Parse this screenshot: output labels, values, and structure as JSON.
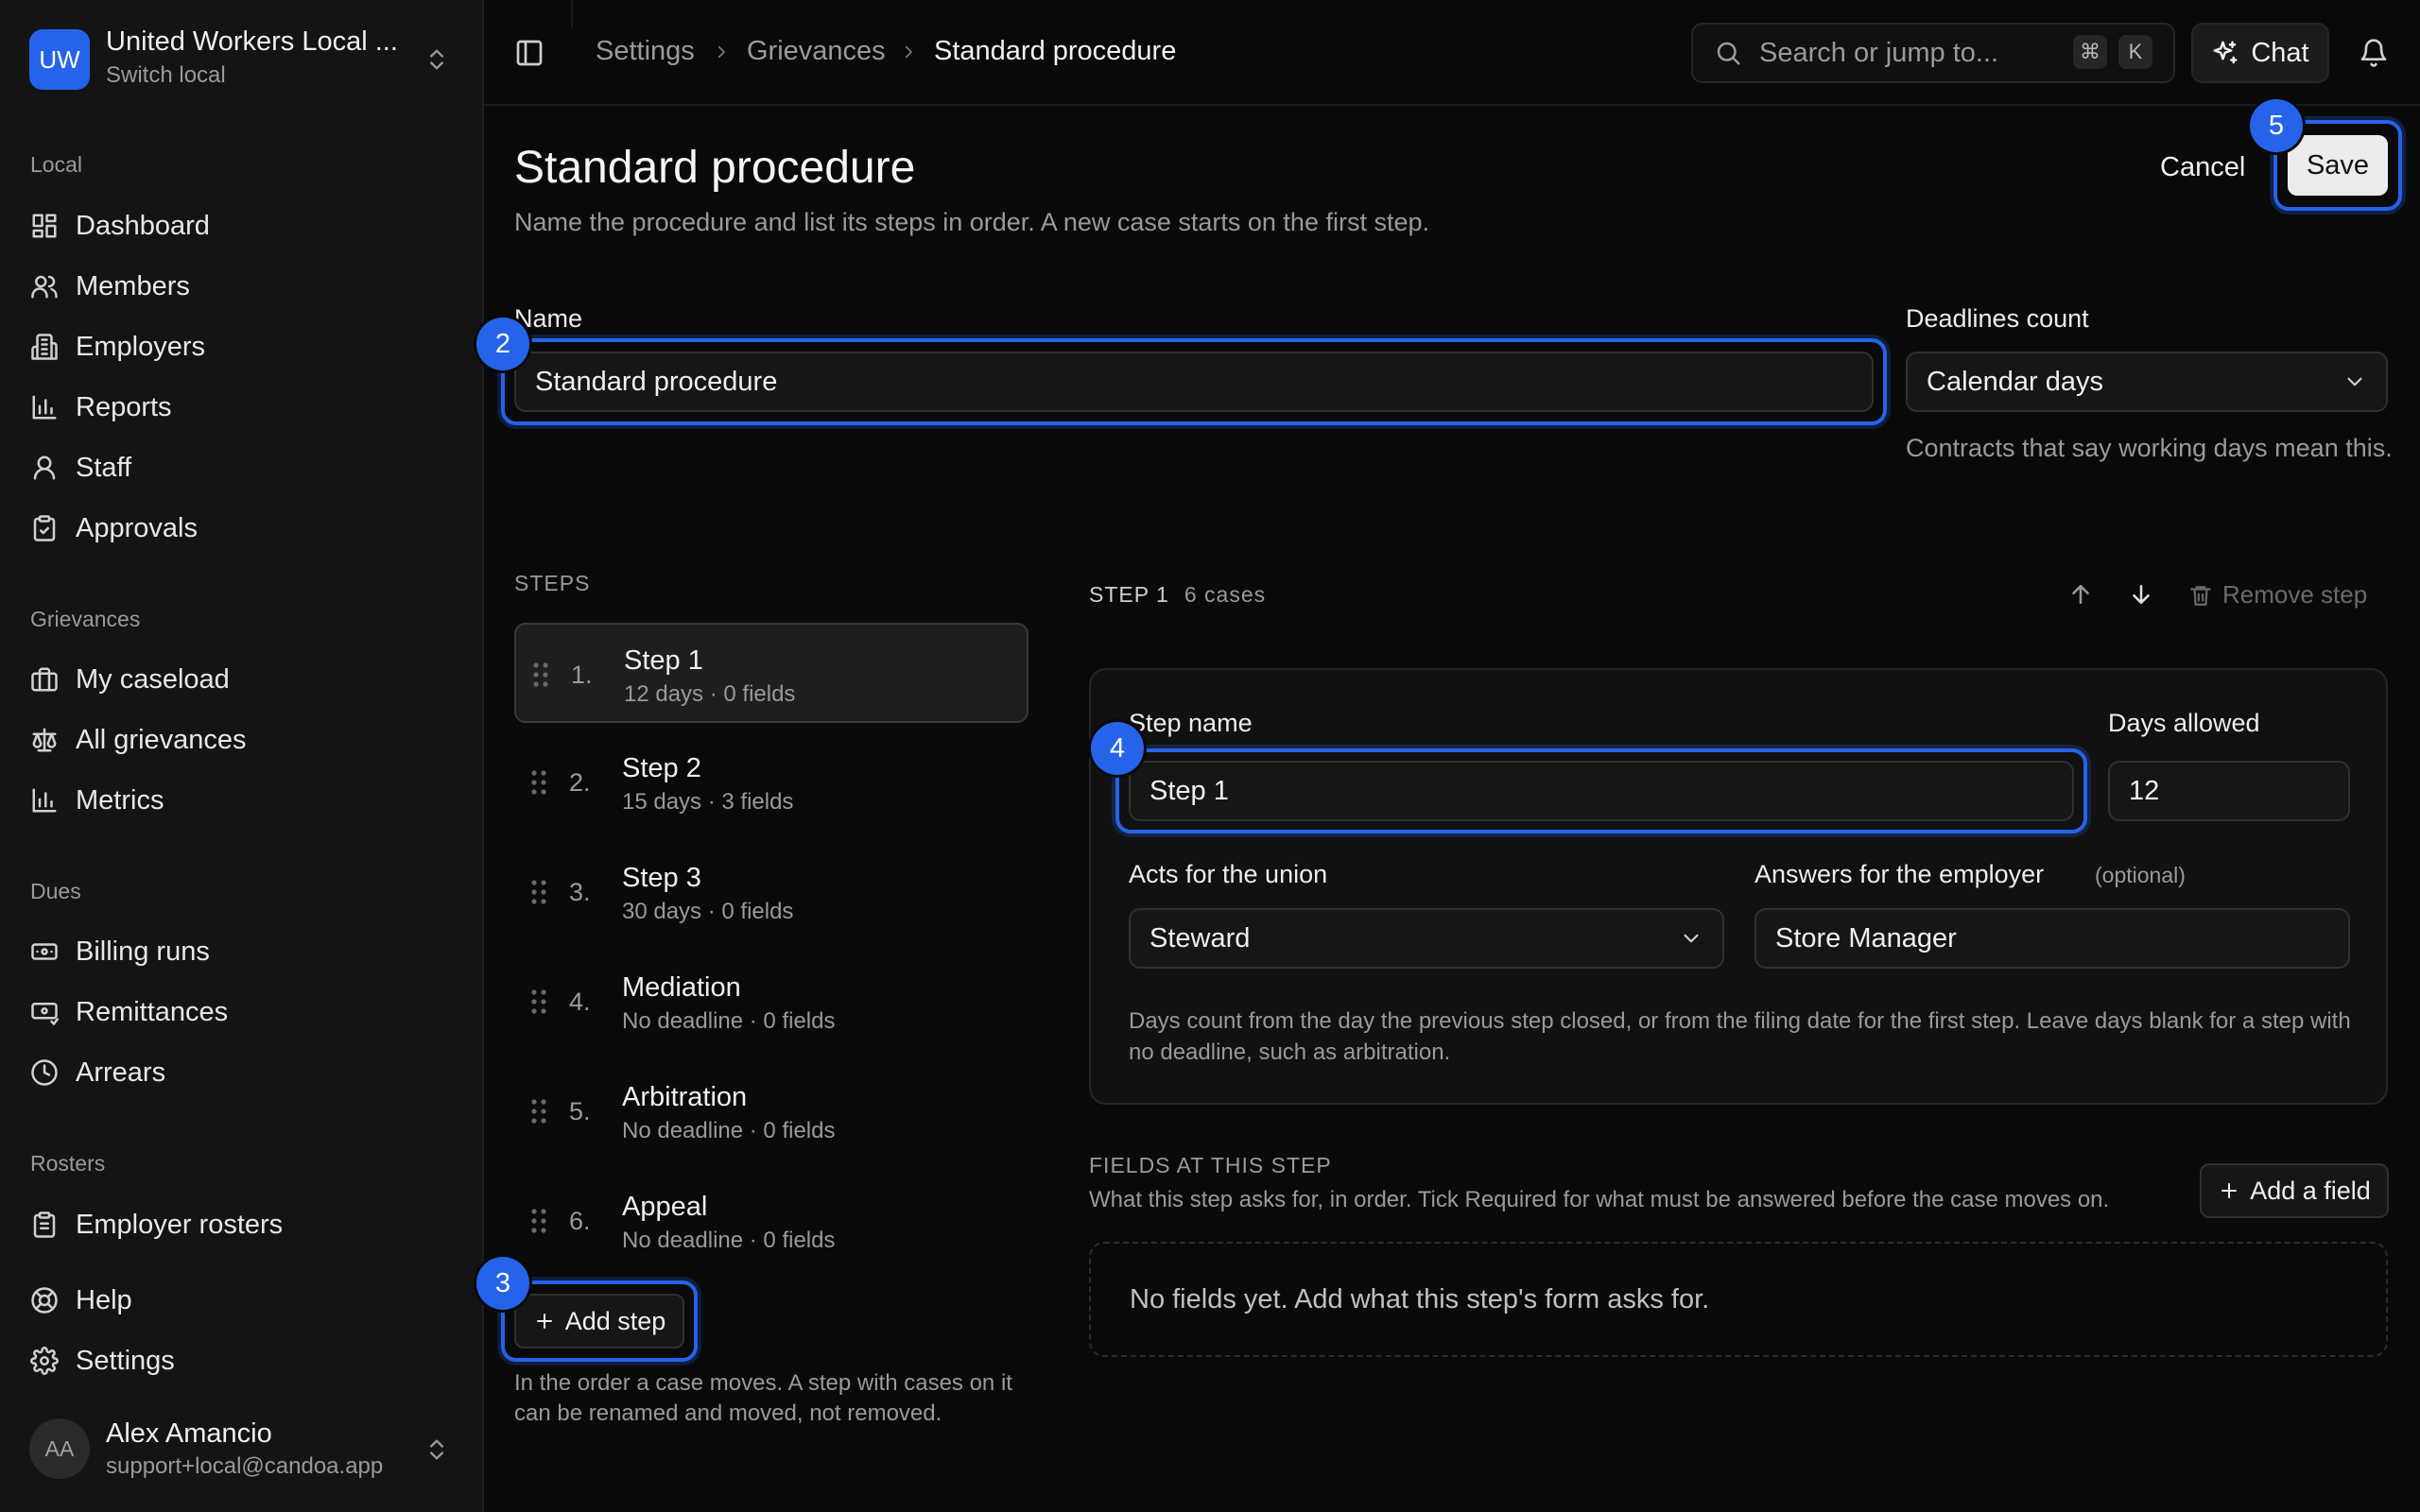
{
  "org": {
    "avatar": "UW",
    "name": "United Workers Local ...",
    "switch_label": "Switch local"
  },
  "sidebar": {
    "sections": [
      {
        "label": "Local",
        "items": [
          {
            "label": "Dashboard",
            "icon": "dashboard-icon"
          },
          {
            "label": "Members",
            "icon": "members-icon"
          },
          {
            "label": "Employers",
            "icon": "building-icon"
          },
          {
            "label": "Reports",
            "icon": "bar-chart-icon"
          },
          {
            "label": "Staff",
            "icon": "user-icon"
          },
          {
            "label": "Approvals",
            "icon": "clipboard-check-icon"
          }
        ]
      },
      {
        "label": "Grievances",
        "items": [
          {
            "label": "My caseload",
            "icon": "briefcase-icon"
          },
          {
            "label": "All grievances",
            "icon": "scale-icon"
          },
          {
            "label": "Metrics",
            "icon": "bar-chart-icon"
          }
        ]
      },
      {
        "label": "Dues",
        "items": [
          {
            "label": "Billing runs",
            "icon": "banknote-icon"
          },
          {
            "label": "Remittances",
            "icon": "receipt-icon"
          },
          {
            "label": "Arrears",
            "icon": "clock-icon"
          }
        ]
      },
      {
        "label": "Rosters",
        "items": [
          {
            "label": "Employer rosters",
            "icon": "clipboard-list-icon"
          }
        ]
      }
    ],
    "footer_items": [
      {
        "label": "Help",
        "icon": "lifebuoy-icon"
      },
      {
        "label": "Settings",
        "icon": "gear-icon"
      }
    ],
    "user": {
      "initials": "AA",
      "name": "Alex Amancio",
      "email": "support+local@candoa.app"
    }
  },
  "topbar": {
    "breadcrumbs": [
      "Settings",
      "Grievances",
      "Standard procedure"
    ],
    "search_placeholder": "Search or jump to...",
    "shortcut_keys": [
      "⌘",
      "K"
    ],
    "chat_label": "Chat"
  },
  "header": {
    "title": "Standard procedure",
    "description": "Name the procedure and list its steps in order. A new case starts on the first step.",
    "cancel_label": "Cancel",
    "save_label": "Save"
  },
  "markers": [
    "2",
    "3",
    "4",
    "5"
  ],
  "form": {
    "name_label": "Name",
    "name_value": "Standard procedure",
    "deadlines_label": "Deadlines count",
    "deadlines_value": "Calendar days",
    "deadlines_hint": "Contracts that say working days mean this."
  },
  "steps": {
    "heading": "STEPS",
    "items": [
      {
        "num": "1.",
        "name": "Step 1",
        "meta": "12 days · 0 fields"
      },
      {
        "num": "2.",
        "name": "Step 2",
        "meta": "15 days · 3 fields"
      },
      {
        "num": "3.",
        "name": "Step 3",
        "meta": "30 days · 0 fields"
      },
      {
        "num": "4.",
        "name": "Mediation",
        "meta": "No deadline · 0 fields"
      },
      {
        "num": "5.",
        "name": "Arbitration",
        "meta": "No deadline · 0 fields"
      },
      {
        "num": "6.",
        "name": "Appeal",
        "meta": "No deadline · 0 fields"
      }
    ],
    "add_label": "Add step",
    "note": "In the order a case moves. A step with cases on it can be renamed and moved, not removed."
  },
  "detail": {
    "step_label": "STEP 1",
    "cases": "6 cases",
    "remove_label": "Remove step",
    "step_name_label": "Step name",
    "step_name_value": "Step 1",
    "days_label": "Days allowed",
    "days_value": "12",
    "acts_label": "Acts for the union",
    "acts_value": "Steward",
    "answers_label": "Answers for the employer",
    "answers_optional": "(optional)",
    "answers_value": "Store Manager",
    "note": "Days count from the day the previous step closed, or from the filing date for the first step. Leave days blank for a step with no deadline, such as arbitration."
  },
  "fields": {
    "heading": "FIELDS AT THIS STEP",
    "subtitle": "What this step asks for, in order. Tick Required for what must be answered before the case moves on.",
    "add_label": "Add a field",
    "empty": "No fields yet. Add what this step's form asks for."
  },
  "colors": {
    "accent": "#2563eb",
    "background": "#0a0a0a",
    "sidebar": "#141414"
  }
}
